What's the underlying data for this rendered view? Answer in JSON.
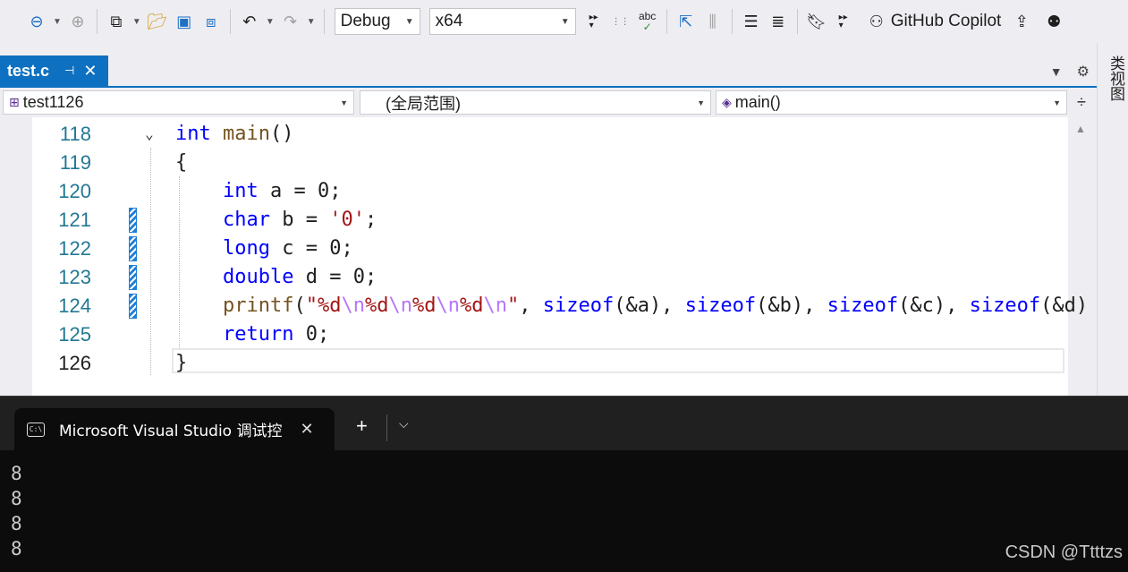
{
  "toolbar": {
    "config": "Debug",
    "platform": "x64",
    "copilot_label": "GitHub Copilot"
  },
  "side_panel": {
    "label": "类视图"
  },
  "document_tab": {
    "title": "test.c"
  },
  "nav": {
    "project": "test1126",
    "scope": "(全局范围)",
    "member": "main()"
  },
  "editor": {
    "lines": [
      {
        "num": "118",
        "parts": [
          [
            "kw",
            "int"
          ],
          [
            "",
            " "
          ],
          [
            "fn",
            "main"
          ],
          [
            "",
            "()"
          ]
        ]
      },
      {
        "num": "119",
        "parts": [
          [
            "",
            "{"
          ]
        ]
      },
      {
        "num": "120",
        "parts": [
          [
            "",
            "    "
          ],
          [
            "kw",
            "int"
          ],
          [
            "",
            " a = 0;"
          ]
        ]
      },
      {
        "num": "121",
        "parts": [
          [
            "",
            "    "
          ],
          [
            "kw",
            "char"
          ],
          [
            "",
            " b = "
          ],
          [
            "str",
            "'0'"
          ],
          [
            "",
            ";"
          ]
        ]
      },
      {
        "num": "122",
        "parts": [
          [
            "",
            "    "
          ],
          [
            "kw",
            "long"
          ],
          [
            "",
            " c = 0;"
          ]
        ]
      },
      {
        "num": "123",
        "parts": [
          [
            "",
            "    "
          ],
          [
            "kw",
            "double"
          ],
          [
            "",
            " d = 0;"
          ]
        ]
      },
      {
        "num": "124",
        "parts": [
          [
            "",
            "    "
          ],
          [
            "fn",
            "printf"
          ],
          [
            "",
            "("
          ],
          [
            "str",
            "\"%d"
          ],
          [
            "esc",
            "\\n"
          ],
          [
            "str",
            "%d"
          ],
          [
            "esc",
            "\\n"
          ],
          [
            "str",
            "%d"
          ],
          [
            "esc",
            "\\n"
          ],
          [
            "str",
            "%d"
          ],
          [
            "esc",
            "\\n"
          ],
          [
            "str",
            "\""
          ],
          [
            "",
            ", "
          ],
          [
            "kw",
            "sizeof"
          ],
          [
            "",
            "(&a), "
          ],
          [
            "kw",
            "sizeof"
          ],
          [
            "",
            "(&b), "
          ],
          [
            "kw",
            "sizeof"
          ],
          [
            "",
            "(&c), "
          ],
          [
            "kw",
            "sizeof"
          ],
          [
            "",
            "(&d)"
          ]
        ]
      },
      {
        "num": "125",
        "parts": [
          [
            "",
            "    "
          ],
          [
            "kw",
            "return"
          ],
          [
            "",
            " 0;"
          ]
        ]
      },
      {
        "num": "126",
        "parts": [
          [
            "",
            "}"
          ]
        ]
      }
    ]
  },
  "terminal": {
    "tab_title": "Microsoft Visual Studio 调试控",
    "output": [
      "8",
      "8",
      "8",
      "8"
    ]
  },
  "watermark": "CSDN @Ttttzs",
  "colors": {
    "accent": "#0e70c0",
    "keyword": "#0000ff",
    "function": "#74531f",
    "string": "#a31515",
    "escape": "#b776fb",
    "line_number": "#237893",
    "terminal_bg": "#0c0c0c"
  }
}
